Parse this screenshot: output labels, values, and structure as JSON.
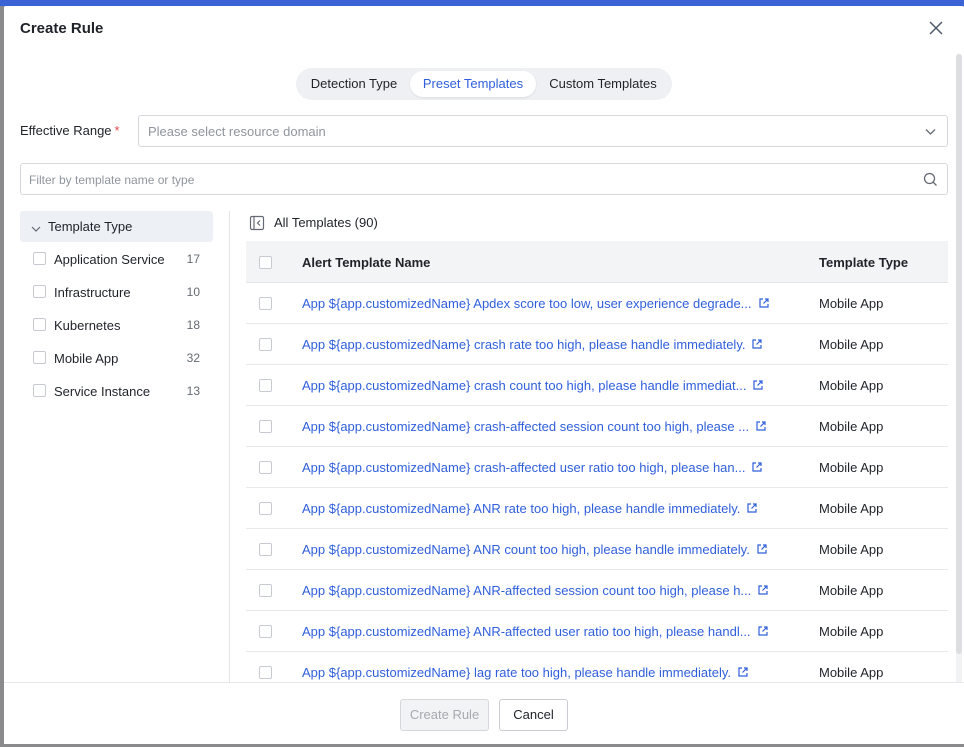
{
  "modal": {
    "title": "Create Rule"
  },
  "tabs": [
    {
      "label": "Detection Type",
      "active": false
    },
    {
      "label": "Preset Templates",
      "active": true
    },
    {
      "label": "Custom Templates",
      "active": false
    }
  ],
  "effective_range": {
    "label": "Effective Range",
    "required_mark": "*",
    "placeholder": "Please select resource domain"
  },
  "search": {
    "placeholder": "Filter by template name or type"
  },
  "tree": {
    "header": "Template Type",
    "items": [
      {
        "label": "Application Service",
        "count": "17"
      },
      {
        "label": "Infrastructure",
        "count": "10"
      },
      {
        "label": "Kubernetes",
        "count": "18"
      },
      {
        "label": "Mobile App",
        "count": "32"
      },
      {
        "label": "Service Instance",
        "count": "13"
      }
    ]
  },
  "list": {
    "title": "All Templates (90)",
    "columns": [
      "Alert Template Name",
      "Template Type"
    ],
    "rows": [
      {
        "name": "App ${app.customizedName} Apdex score too low, user experience degrade...",
        "type": "Mobile App"
      },
      {
        "name": "App ${app.customizedName} crash rate too high, please handle immediately.",
        "type": "Mobile App"
      },
      {
        "name": "App ${app.customizedName} crash count too high, please handle immediat...",
        "type": "Mobile App"
      },
      {
        "name": "App ${app.customizedName} crash-affected session count too high, please ...",
        "type": "Mobile App"
      },
      {
        "name": "App ${app.customizedName} crash-affected user ratio too high, please han...",
        "type": "Mobile App"
      },
      {
        "name": "App ${app.customizedName} ANR rate too high, please handle immediately.",
        "type": "Mobile App"
      },
      {
        "name": "App ${app.customizedName} ANR count too high, please handle immediately.",
        "type": "Mobile App"
      },
      {
        "name": "App ${app.customizedName} ANR-affected session count too high, please h...",
        "type": "Mobile App"
      },
      {
        "name": "App ${app.customizedName} ANR-affected user ratio too high, please handl...",
        "type": "Mobile App"
      },
      {
        "name": "App ${app.customizedName} lag rate too high, please handle immediately.",
        "type": "Mobile App"
      }
    ]
  },
  "footer": {
    "create_label": "Create Rule",
    "cancel_label": "Cancel"
  },
  "colors": {
    "accent": "#2f5fdc",
    "link": "#2f5fdc",
    "required": "#e34d4d"
  },
  "icons": [
    "close-icon",
    "chevron-down-icon",
    "search-icon",
    "collapse-panel-icon",
    "external-link-icon"
  ]
}
